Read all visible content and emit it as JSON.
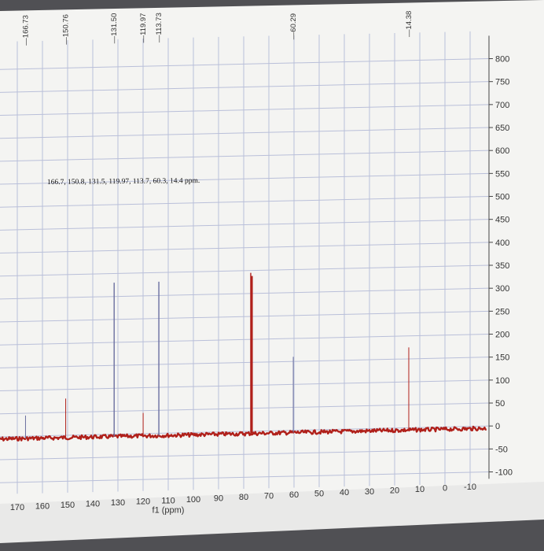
{
  "chart_data": {
    "type": "line",
    "title": "",
    "xlabel": "f1 (ppm)",
    "ylabel": "",
    "xlim": [
      175,
      -15
    ],
    "ylim": [
      -125,
      850
    ],
    "x_ticks": [
      "170",
      "160",
      "150",
      "140",
      "130",
      "120",
      "110",
      "100",
      "90",
      "80",
      "70",
      "60",
      "50",
      "40",
      "30",
      "20",
      "10",
      "0",
      "-10"
    ],
    "y_ticks": [
      "800",
      "750",
      "700",
      "650",
      "600",
      "550",
      "500",
      "450",
      "400",
      "350",
      "300",
      "250",
      "200",
      "150",
      "100",
      "50",
      "0",
      "-50",
      "-100"
    ],
    "grid": true,
    "annotation": "166.7, 150.8, 131.5, 119.97, 113.7, 60.3, 14.4 ppm.",
    "peak_labels": [
      "166.73",
      "150.76",
      "131.50",
      "119.97",
      "113.73",
      "60.29",
      "14.38"
    ],
    "series": [
      {
        "name": "",
        "color": "#b0201a",
        "baseline": -5,
        "peaks": [
          {
            "x": 166.73,
            "y": 45
          },
          {
            "x": 150.76,
            "y": 80
          },
          {
            "x": 131.5,
            "y": 330
          },
          {
            "x": 119.97,
            "y": 45
          },
          {
            "x": 113.73,
            "y": 330
          },
          {
            "x": 77.2,
            "y": 345
          },
          {
            "x": 60.29,
            "y": 160
          },
          {
            "x": 14.38,
            "y": 175
          }
        ]
      }
    ]
  },
  "colors": {
    "grid": "#b9bfd9",
    "axis": "#444444",
    "spectrum": "#b0201a",
    "peak_line": "#6b6fa0"
  }
}
